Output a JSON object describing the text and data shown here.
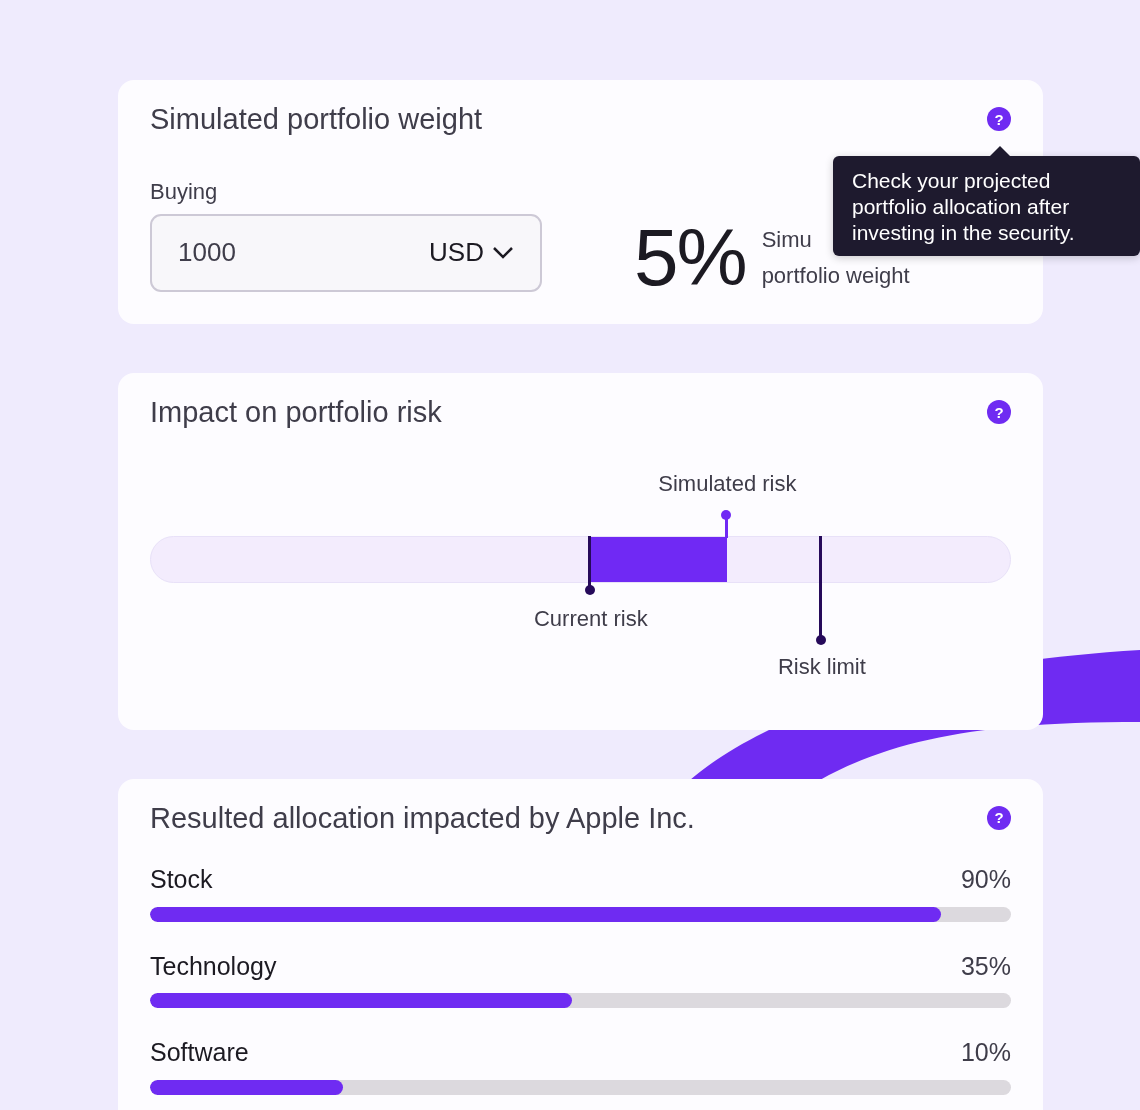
{
  "weight_card": {
    "title": "Simulated portfolio weight",
    "help": "?",
    "buying_label": "Buying",
    "amount": "1000",
    "currency": "USD",
    "weight_value": "5%",
    "weight_label_lines": [
      "Simu",
      "portfolio weight"
    ],
    "tooltip": {
      "text": "Check your projected\nportfolio allocation after\ninvesting in the security."
    }
  },
  "risk_card": {
    "title": "Impact on portfolio risk",
    "help": "?",
    "current": {
      "label": "Current risk"
    },
    "simulated": {
      "label": "Simulated risk",
      "level": 0.671
    },
    "limit": {
      "label": "Risk limit"
    }
  },
  "allocation_card": {
    "title": "Resulted allocation impacted by Apple Inc.",
    "help": "?",
    "rows": [
      {
        "name": "Stock",
        "value": "90%",
        "level": 0.919
      },
      {
        "name": "Technology",
        "value": "35%",
        "level": 0.49
      },
      {
        "name": "Software",
        "value": "10%",
        "level": 0.224
      }
    ]
  }
}
